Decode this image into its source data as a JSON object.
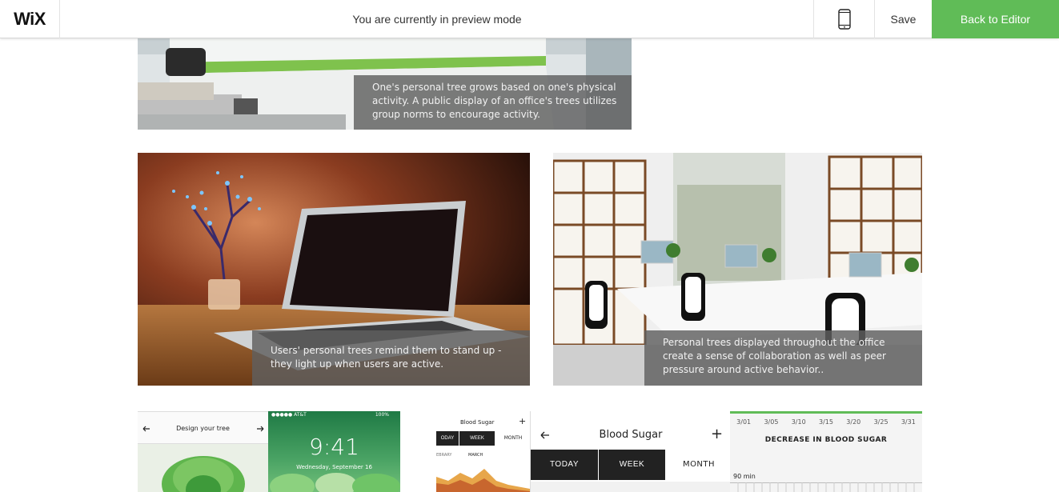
{
  "topbar": {
    "logo": "WiX",
    "mode_text": "You are currently in preview mode",
    "save_label": "Save",
    "editor_label": "Back to Editor",
    "accent": "#60bc57",
    "mobile_icon": "mobile-phone-icon"
  },
  "gallery": {
    "captions": {
      "office": "One's personal tree grows based on one's physical activity. A public display of an office's trees utilizes group norms to encourage activity.",
      "laptop": "Users' personal trees remind them to stand up - they light up when users are active.",
      "workspace": "Personal trees displayed throughout the office create a sense of collaboration as well as peer pressure around active behavior.."
    }
  },
  "app_left": {
    "title": "Design your tree"
  },
  "app_lock": {
    "carrier": "●●●●● AT&T",
    "battery": "100%",
    "time": "9:41",
    "date": "Wednesday, September 16"
  },
  "app_bs_small": {
    "title": "Blood Sugar",
    "tabs": [
      "ODAY",
      "WEEK",
      "MONTH"
    ],
    "months": [
      "EBRARY",
      "MARCH"
    ]
  },
  "app_bs_main": {
    "title": "Blood Sugar",
    "tabs": [
      "TODAY",
      "WEEK",
      "MONTH"
    ]
  },
  "app_chart": {
    "dates": [
      "3/01",
      "3/05",
      "3/10",
      "3/15",
      "3/20",
      "3/25",
      "3/31"
    ],
    "title": "DECREASE IN BLOOD SUGAR",
    "value_label": "90 min"
  }
}
